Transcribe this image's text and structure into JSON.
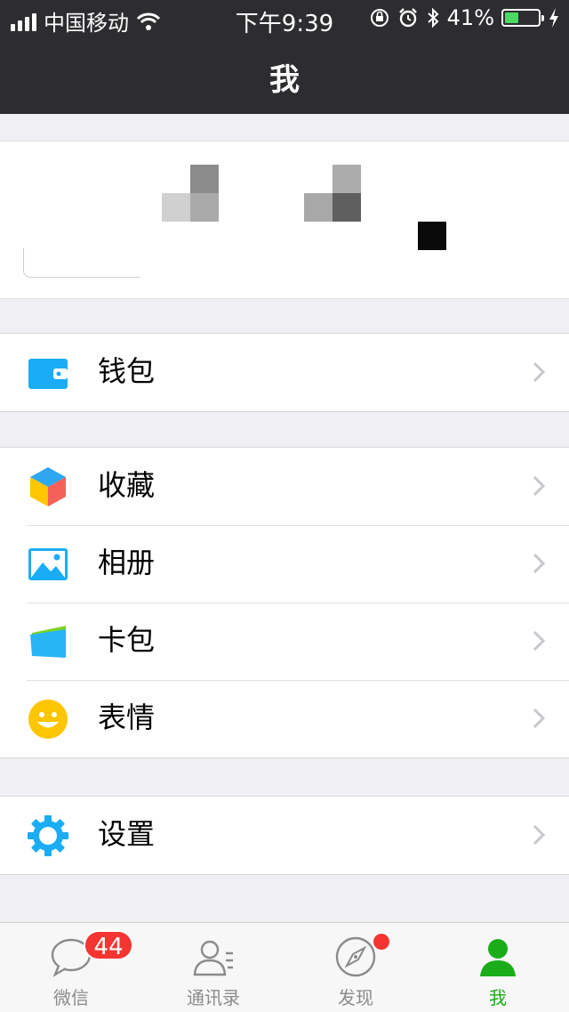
{
  "status_bar": {
    "carrier": "中国移动",
    "time": "下午9:39",
    "battery": "41%",
    "battery_level": 0.41
  },
  "nav": {
    "title": "我"
  },
  "menu": {
    "wallet": "钱包",
    "favorites": "收藏",
    "album": "相册",
    "cards": "卡包",
    "stickers": "表情",
    "settings": "设置"
  },
  "tabs": [
    {
      "label": "微信",
      "badge": "44"
    },
    {
      "label": "通讯录"
    },
    {
      "label": "发现"
    },
    {
      "label": "我"
    }
  ],
  "colors": {
    "nav_bg": "#2d2d30",
    "accent_blue": "#1aadf5",
    "badge_red": "#f43531",
    "active_green": "#1aad19"
  }
}
